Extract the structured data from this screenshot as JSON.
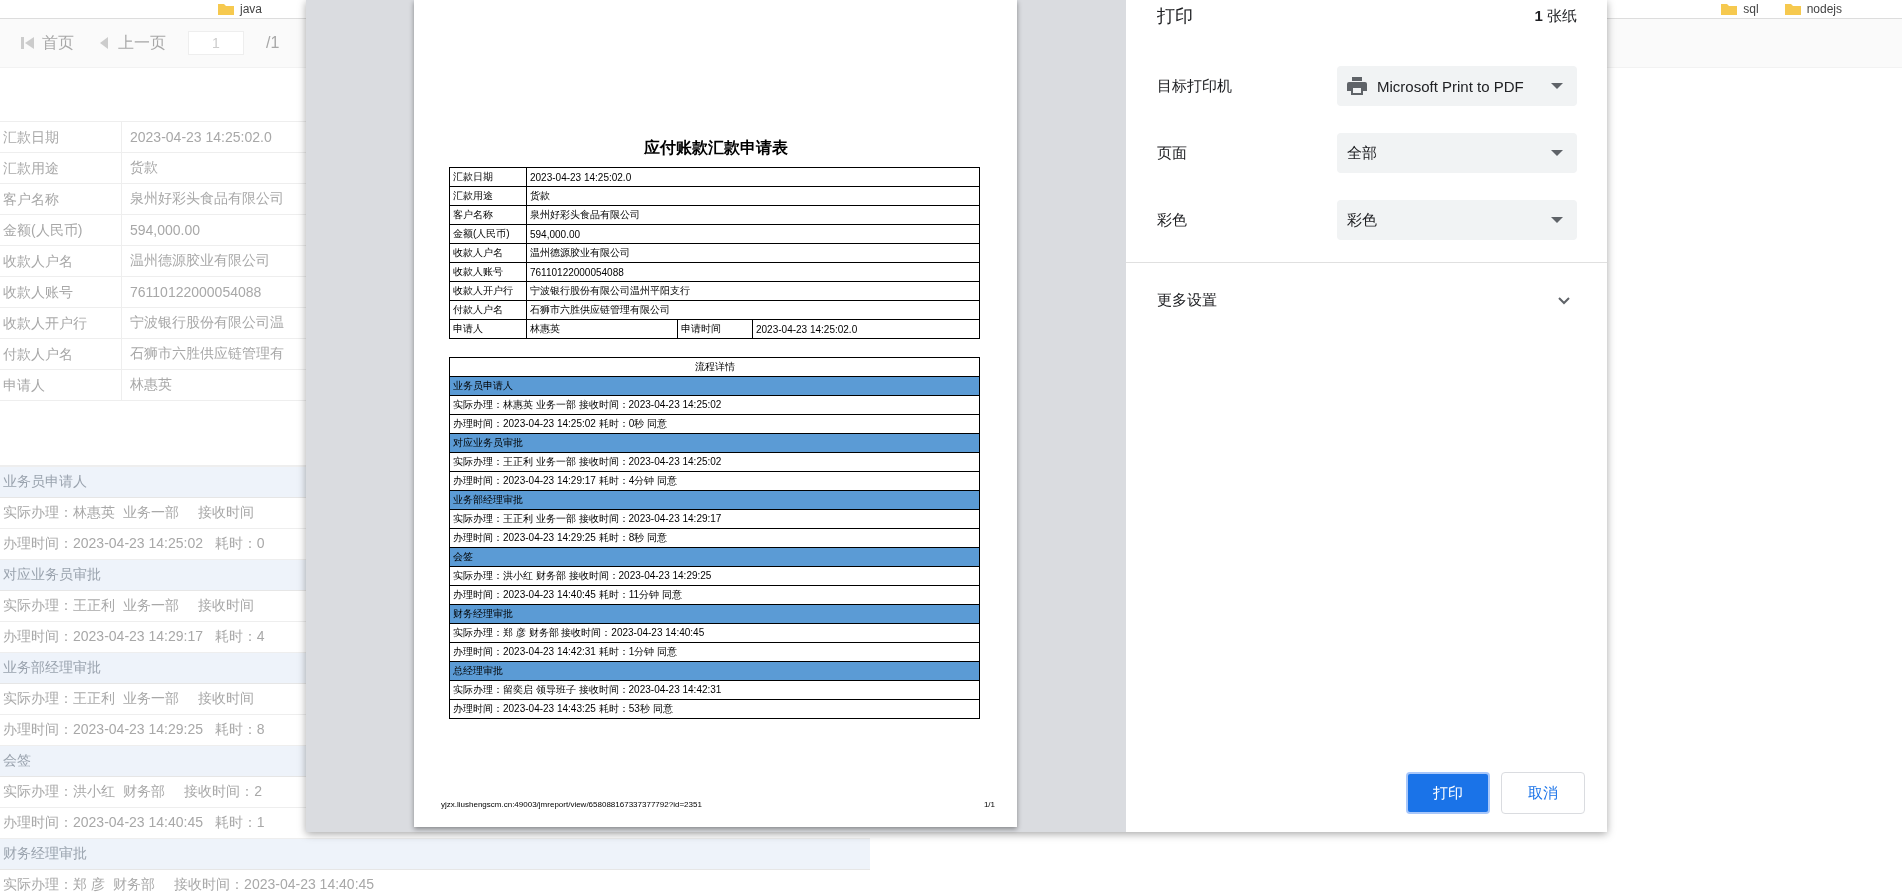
{
  "background_page": {
    "bookmarks": [
      {
        "label": "java"
      },
      {
        "label": "sql"
      },
      {
        "label": "nodejs"
      }
    ],
    "toolbar": {
      "first": "首页",
      "prev": "上一页",
      "page": "1",
      "total": "/1"
    },
    "fields": [
      {
        "label": "汇款日期",
        "value": "2023-04-23 14:25:02.0"
      },
      {
        "label": "汇款用途",
        "value": "货款"
      },
      {
        "label": "客户名称",
        "value": "泉州好彩头食品有限公司"
      },
      {
        "label": "金额(人民币)",
        "value": "594,000.00"
      },
      {
        "label": "收款人户名",
        "value": "温州德源胶业有限公司"
      },
      {
        "label": "收款人账号",
        "value": "76110122000054088"
      },
      {
        "label": "收款人开户行",
        "value": "宁波银行股份有限公司温"
      },
      {
        "label": "付款人户名",
        "value": "石狮市六胜供应链管理有"
      },
      {
        "label": "申请人",
        "value": "林惠英"
      }
    ],
    "flow": [
      {
        "step": "业务员申请人",
        "rows": [
          "实际办理：林惠英  业务一部     接收时间",
          "办理时间：2023-04-23 14:25:02   耗时：0"
        ]
      },
      {
        "step": "对应业务员审批",
        "rows": [
          "实际办理：王正利  业务一部     接收时间",
          "办理时间：2023-04-23 14:29:17   耗时：4"
        ]
      },
      {
        "step": "业务部经理审批",
        "rows": [
          "实际办理：王正利  业务一部     接收时间",
          "办理时间：2023-04-23 14:29:25   耗时：8"
        ]
      },
      {
        "step": "会签",
        "rows": [
          "实际办理：洪小红  财务部     接收时间：2",
          "办理时间：2023-04-23 14:40:45   耗时：1"
        ]
      },
      {
        "step": "财务经理审批",
        "rows": [
          "实际办理：郑 彦  财务部     接收时间：2023-04-23 14:40:45"
        ]
      }
    ]
  },
  "report": {
    "title": "应付账款汇款申请表",
    "fields": [
      {
        "label": "汇款日期",
        "value": "2023-04-23 14:25:02.0"
      },
      {
        "label": "汇款用途",
        "value": "货款"
      },
      {
        "label": "客户名称",
        "value": "泉州好彩头食品有限公司"
      },
      {
        "label": "金额(人民币)",
        "value": "594,000.00"
      },
      {
        "label": "收款人户名",
        "value": "温州德源胶业有限公司"
      },
      {
        "label": "收款人账号",
        "value": "76110122000054088"
      },
      {
        "label": "收款人开户行",
        "value": "宁波银行股份有限公司温州平阳支行"
      },
      {
        "label": "付款人户名",
        "value": "石狮市六胜供应链管理有限公司"
      }
    ],
    "applicant": {
      "label": "申请人",
      "value": "林惠英",
      "time_label": "申请时间",
      "time": "2023-04-23 14:25:02.0"
    },
    "flow_title": "流程详情",
    "flow": [
      {
        "step": "业务员申请人",
        "rows": [
          "实际办理：林惠英 业务一部 接收时间：2023-04-23 14:25:02",
          "办理时间：2023-04-23 14:25:02 耗时：0秒 同意"
        ]
      },
      {
        "step": "对应业务员审批",
        "rows": [
          "实际办理：王正利 业务一部 接收时间：2023-04-23 14:25:02",
          "办理时间：2023-04-23 14:29:17 耗时：4分钟 同意"
        ]
      },
      {
        "step": "业务部经理审批",
        "rows": [
          "实际办理：王正利 业务一部 接收时间：2023-04-23 14:29:17",
          "办理时间：2023-04-23 14:29:25 耗时：8秒 同意"
        ]
      },
      {
        "step": "会签",
        "rows": [
          "实际办理：洪小红 财务部 接收时间：2023-04-23 14:29:25",
          "办理时间：2023-04-23 14:40:45 耗时：11分钟 同意"
        ]
      },
      {
        "step": "财务经理审批",
        "rows": [
          "实际办理：郑 彦 财务部 接收时间：2023-04-23 14:40:45",
          "办理时间：2023-04-23 14:42:31 耗时：1分钟 同意"
        ]
      },
      {
        "step": "总经理审批",
        "rows": [
          "实际办理：留奕启 领导班子 接收时间：2023-04-23 14:42:31",
          "办理时间：2023-04-23 14:43:25 耗时：53秒 同意"
        ]
      }
    ],
    "footer_url": "yjzx.liushengscm.cn:49003/jmreport/view/658088167337377792?id=2351",
    "page_number": "1/1"
  },
  "print_panel": {
    "title": "打印",
    "sheets_count": "1",
    "sheets_unit": "张纸",
    "settings": [
      {
        "label": "目标打印机",
        "value": "Microsoft Print to PDF",
        "kind": "printer"
      },
      {
        "label": "页面",
        "value": "全部",
        "kind": "select"
      },
      {
        "label": "彩色",
        "value": "彩色",
        "kind": "select"
      }
    ],
    "more": {
      "label": "更多设置",
      "expanded": false
    },
    "buttons": [
      {
        "label": "打印",
        "kind": "primary"
      },
      {
        "label": "取消",
        "kind": "secondary"
      }
    ]
  }
}
